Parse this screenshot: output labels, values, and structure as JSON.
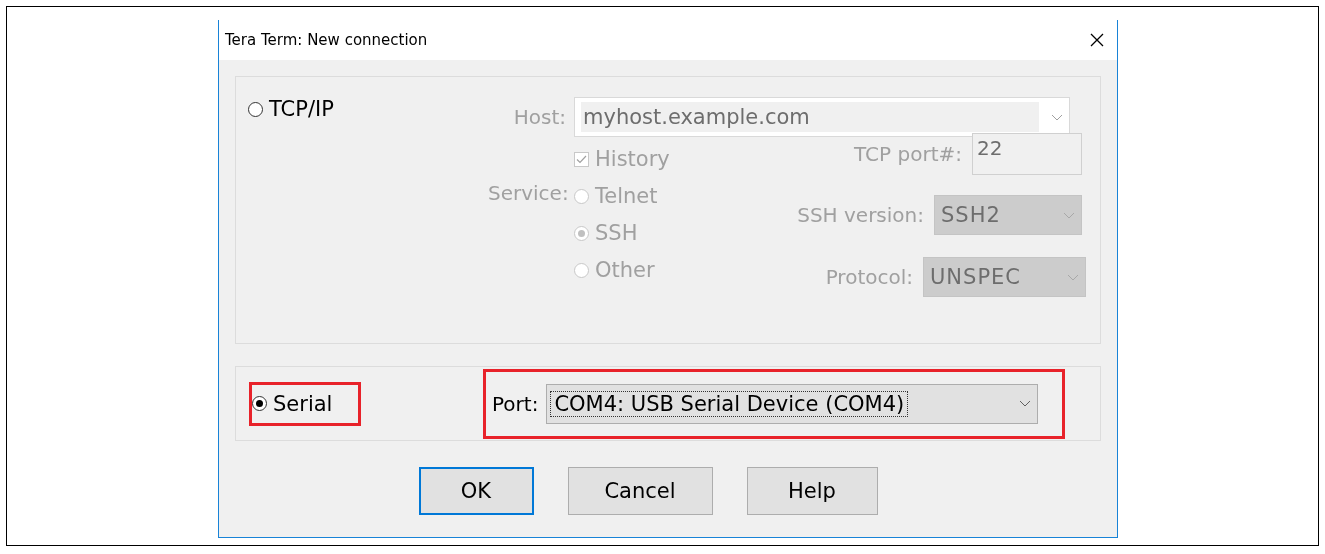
{
  "window": {
    "title": "Tera Term: New connection"
  },
  "tcpip": {
    "label": "TCP/IP",
    "selected": false,
    "disabled": true,
    "host": {
      "label": "Host:",
      "value": "myhost.example.com"
    },
    "history": {
      "label": "History",
      "checked": true
    },
    "service": {
      "label": "Service:",
      "options": [
        {
          "label": "Telnet",
          "selected": false
        },
        {
          "label": "SSH",
          "selected": true
        },
        {
          "label": "Other",
          "selected": false
        }
      ]
    },
    "tcp_port": {
      "label": "TCP port#:",
      "value": "22"
    },
    "ssh_version": {
      "label": "SSH version:",
      "value": "SSH2"
    },
    "protocol": {
      "label": "Protocol:",
      "value": "UNSPEC"
    }
  },
  "serial": {
    "label": "Serial",
    "selected": true,
    "highlighted": true,
    "port": {
      "label": "Port:",
      "value": "COM4: USB Serial Device (COM4)",
      "highlighted": true
    }
  },
  "buttons": [
    {
      "label": "OK",
      "default": true
    },
    {
      "label": "Cancel",
      "default": false
    },
    {
      "label": "Help",
      "default": false
    }
  ]
}
